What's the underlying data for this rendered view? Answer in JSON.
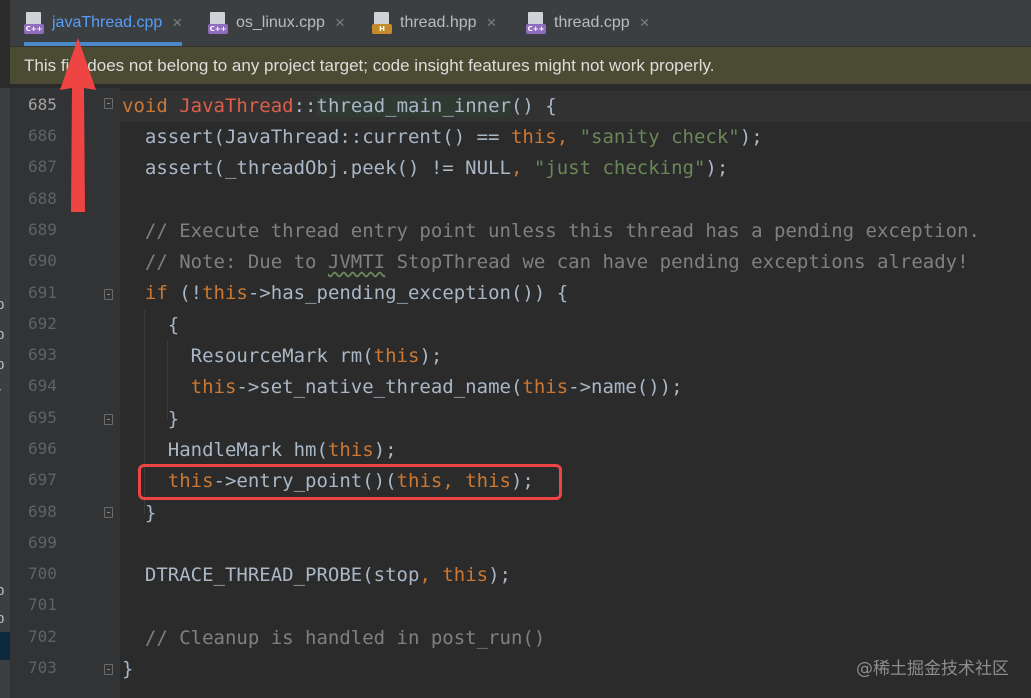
{
  "tabs": [
    {
      "label": "javaThread.cpp",
      "icon": "cpp-file-icon",
      "badge": "C++",
      "active": true
    },
    {
      "label": "os_linux.cpp",
      "icon": "cpp-file-icon",
      "badge": "C++",
      "active": false
    },
    {
      "label": "thread.hpp",
      "icon": "header-file-icon",
      "badge": "H",
      "active": false
    },
    {
      "label": "thread.cpp",
      "icon": "cpp-file-icon",
      "badge": "C++",
      "active": false
    }
  ],
  "banner": {
    "text": "This file does not belong to any project target; code insight features might not work properly."
  },
  "line_numbers": [
    "685",
    "686",
    "687",
    "688",
    "689",
    "690",
    "691",
    "692",
    "693",
    "694",
    "695",
    "696",
    "697",
    "698",
    "699",
    "700",
    "701",
    "702",
    "703"
  ],
  "code": {
    "l685": {
      "kw": "void",
      "cls": "JavaThread",
      "sep": "::",
      "fn": "thread_main_inner",
      "rest": "() {"
    },
    "l686": {
      "a": "assert(JavaThread::current() == ",
      "kw": "this",
      "b": ", ",
      "str": "\"sanity check\"",
      "c": ");"
    },
    "l687": {
      "a": "assert(_threadObj.peek() != NULL",
      "b": ", ",
      "str": "\"just checking\"",
      "c": ");"
    },
    "l689": {
      "comment": "// Execute thread entry point unless this thread has a pending exception."
    },
    "l690": {
      "c1": "// Note: Due to ",
      "c2": "JVMTI",
      "c3": " StopThread we can have pending exceptions already!"
    },
    "l691": {
      "kw": "if",
      "a": " (!",
      "kw2": "this",
      "b": "->has_pending_exception()) {"
    },
    "l692": {
      "a": "{"
    },
    "l693": {
      "a": "ResourceMark rm(",
      "kw": "this",
      "b": ");"
    },
    "l694": {
      "kw": "this",
      "a": "->set_native_thread_name(",
      "kw2": "this",
      "b": "->name());"
    },
    "l695": {
      "a": "}"
    },
    "l696": {
      "a": "HandleMark hm(",
      "kw": "this",
      "b": ");"
    },
    "l697": {
      "kw": "this",
      "a": "->entry_point()(",
      "kw2": "this",
      "b": ", ",
      "kw3": "this",
      "c": ");"
    },
    "l698": {
      "a": "}"
    },
    "l700": {
      "a": "DTRACE_THREAD_PROBE(stop",
      "b": ", ",
      "kw": "this",
      "c": ");"
    },
    "l702": {
      "comment": "// Cleanup is handled in post_run()"
    },
    "l703": {
      "a": "}"
    }
  },
  "watermark": "@稀土掘金技术社区",
  "left_panel_fragments": [
    "p",
    "p",
    "p",
    "r",
    "p",
    "p"
  ],
  "colors": {
    "keyword": "#cc7832",
    "string": "#6a8759",
    "comment": "#808080",
    "class": "#de5e4a",
    "annotation": "#ef4444",
    "active_tab": "#589df6"
  }
}
